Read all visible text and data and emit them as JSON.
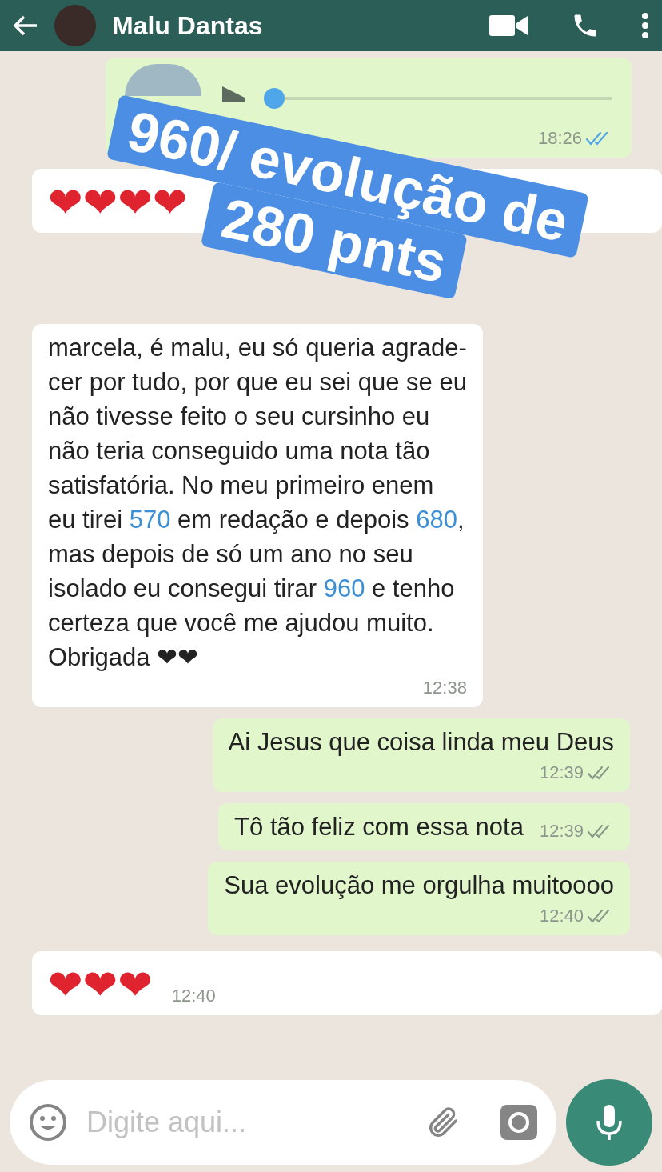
{
  "header": {
    "contact_name": "Malu Dantas"
  },
  "messages": [
    {
      "kind": "voice",
      "outgoing": true,
      "level": 0.0,
      "time": "18:26",
      "read": true
    },
    {
      "kind": "emoji",
      "outgoing": false,
      "text": "❤❤❤❤"
    },
    {
      "kind": "text",
      "outgoing": false,
      "time_inline": false,
      "time": "12:38",
      "lines": [
        [
          {
            "text": "marcela, é malu, eu só queria agrade-",
            "highlight": false
          }
        ],
        [
          {
            "text": "cer por tudo, por que eu sei que se eu",
            "highlight": false
          }
        ],
        [
          {
            "text": "não tivesse feito o seu cursinho eu",
            "highlight": false
          }
        ],
        [
          {
            "text": "não teria conseguido uma nota tão",
            "highlight": false
          }
        ],
        [
          {
            "text": "satisfatória. No meu primeiro enem",
            "highlight": false
          }
        ],
        [
          {
            "text": "eu tirei ",
            "highlight": false
          },
          {
            "text": "570",
            "highlight": true
          },
          {
            "text": " em redação e depois ",
            "highlight": false
          },
          {
            "text": "680",
            "highlight": true
          },
          {
            "text": ",",
            "highlight": false
          }
        ],
        [
          {
            "text": "mas depois de só um ano no seu",
            "highlight": false
          }
        ],
        [
          {
            "text": "isolado eu consegui tirar ",
            "highlight": false
          },
          {
            "text": "960",
            "highlight": true
          },
          {
            "text": " e tenho",
            "highlight": false
          }
        ],
        [
          {
            "text": "certeza que você me ajudou muito.",
            "highlight": false
          }
        ],
        [
          {
            "text": "Obrigada ",
            "highlight": false
          },
          {
            "text": "❤❤",
            "highlight": false
          }
        ]
      ]
    },
    {
      "kind": "text",
      "outgoing": true,
      "time_inline": false,
      "time": "12:39",
      "read": false,
      "lines": [
        [
          {
            "text": "Ai Jesus que coisa linda meu Deus",
            "highlight": false
          }
        ]
      ]
    },
    {
      "kind": "text",
      "outgoing": true,
      "time_inline": true,
      "time": "12:39",
      "read": false,
      "lines": [
        [
          {
            "text": "Tô tão feliz com essa nota",
            "highlight": false
          }
        ]
      ]
    },
    {
      "kind": "text",
      "outgoing": true,
      "time_inline": false,
      "time": "12:40",
      "read": false,
      "lines": [
        [
          {
            "text": "Sua evolução me orgulha muitoooo",
            "highlight": false
          }
        ]
      ]
    },
    {
      "kind": "emoji",
      "outgoing": false,
      "text": "❤❤❤",
      "time": "12:40"
    }
  ],
  "sticker": {
    "lines": [
      "960/ evolução de",
      "280 pnts"
    ]
  },
  "composer": {
    "placeholder": "Digite aqui..."
  }
}
